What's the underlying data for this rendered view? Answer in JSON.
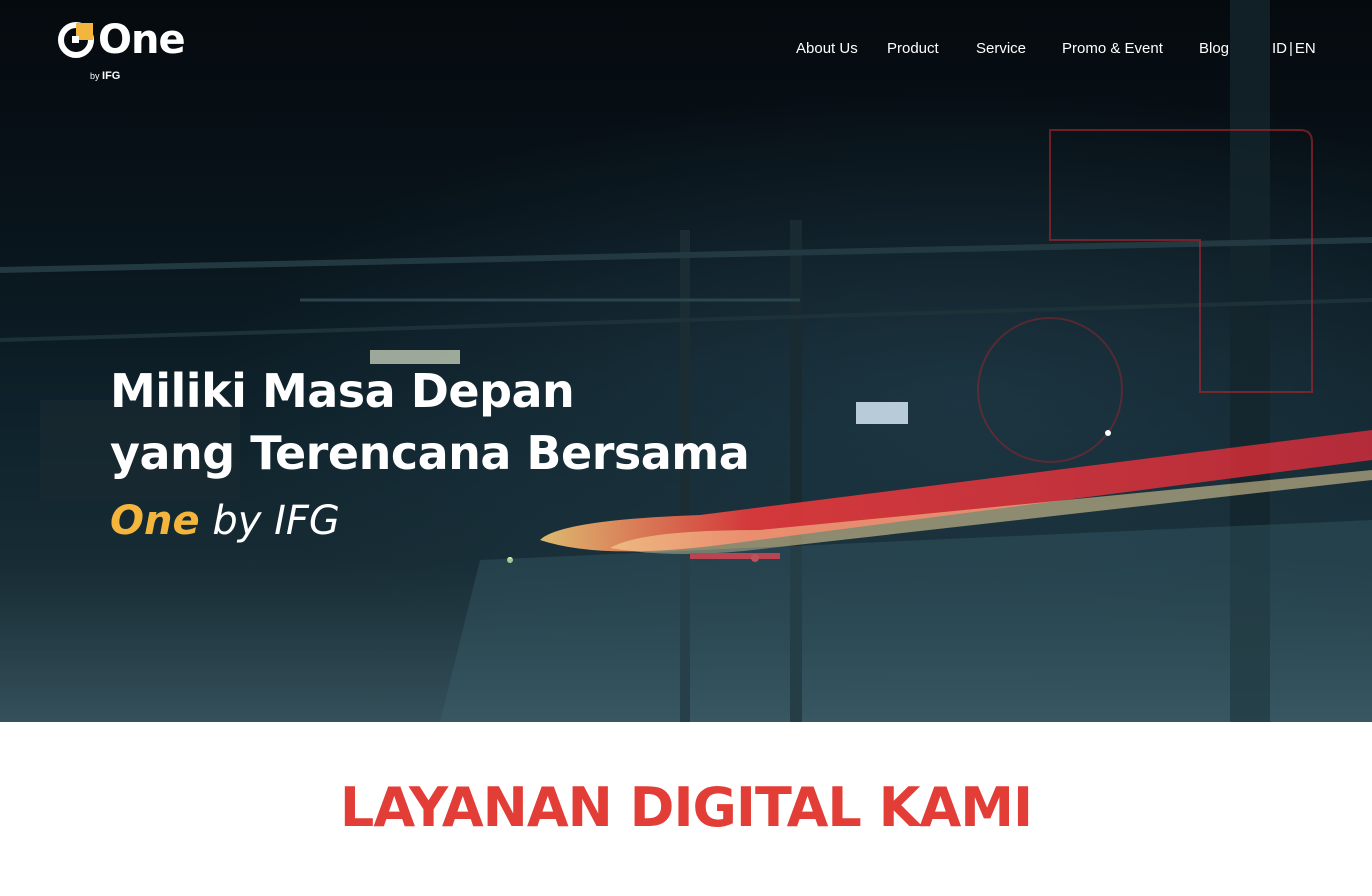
{
  "brand": {
    "logo_text": "One",
    "logo_sub_by": "by",
    "logo_sub_name": "IFG",
    "accent": "#f4b53c"
  },
  "nav": {
    "items": [
      {
        "label": "About Us"
      },
      {
        "label": "Product"
      },
      {
        "label": "Service"
      },
      {
        "label": "Promo & Event"
      },
      {
        "label": "Blog"
      }
    ],
    "lang_id": "ID",
    "lang_sep": "|",
    "lang_en": "EN"
  },
  "hero": {
    "line1": "Miliki Masa Depan",
    "line2": "yang Terencana Bersama",
    "tagline_brand": "One",
    "tagline_rest": " by IFG",
    "background": "night-train-light-trail"
  },
  "section": {
    "title": "LAYANAN DIGITAL KAMI",
    "title_color": "#e23d36"
  }
}
